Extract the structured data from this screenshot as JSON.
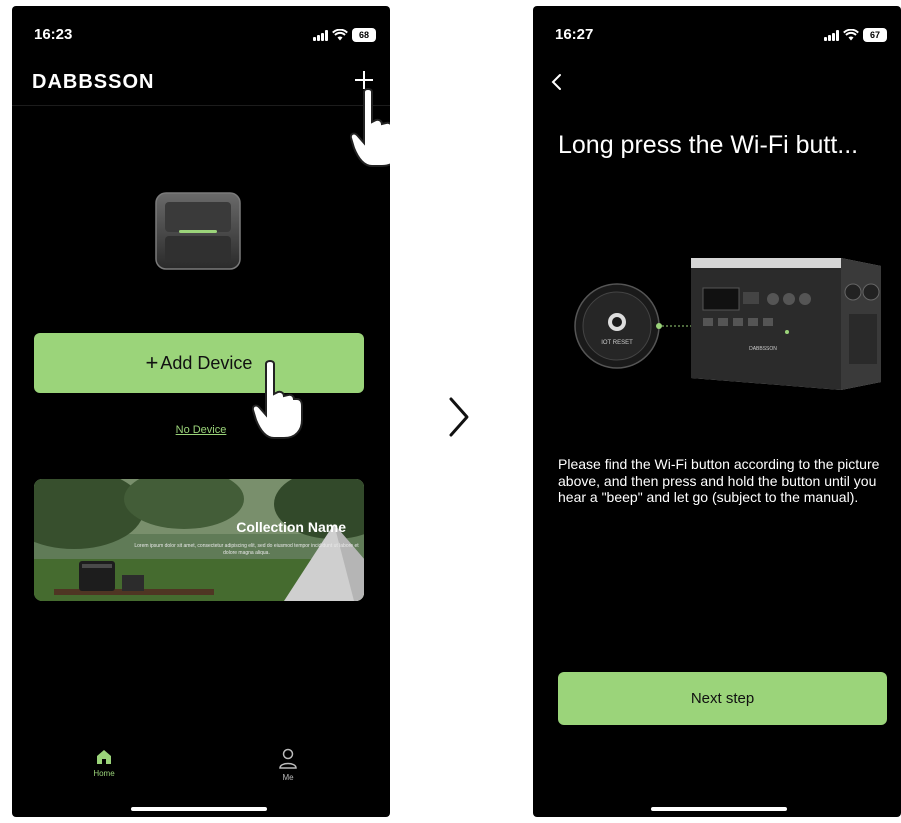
{
  "left_screen": {
    "status_time": "16:23",
    "battery": "68",
    "brand": "DABBSSON",
    "add_device_plus": "+",
    "add_device_label": "Add Device",
    "no_device_label": "No Device",
    "banner": {
      "title": "Collection Name",
      "subtitle": "Lorem ipsum dolor sit amet, consectetur adipiscing elit, sed do eiusmod tempor incididunt ut labore et dolore magna aliqua."
    },
    "tabs": [
      {
        "label": "Home",
        "icon": "home-icon",
        "active": true
      },
      {
        "label": "Me",
        "icon": "person-icon",
        "active": false
      }
    ]
  },
  "right_screen": {
    "status_time": "16:27",
    "battery": "67",
    "title": "Long press the Wi-Fi butt...",
    "iot_reset_label": "IOT RESET",
    "device_brand": "DABBSSON",
    "instruction": "Please find the Wi-Fi button according to the picture above, and then press and hold the button until you hear a \"beep\" and let go (subject to the manual).",
    "next_button": "Next step"
  },
  "colors": {
    "accent": "#9bd47a",
    "background": "#000000",
    "text": "#ffffff"
  }
}
